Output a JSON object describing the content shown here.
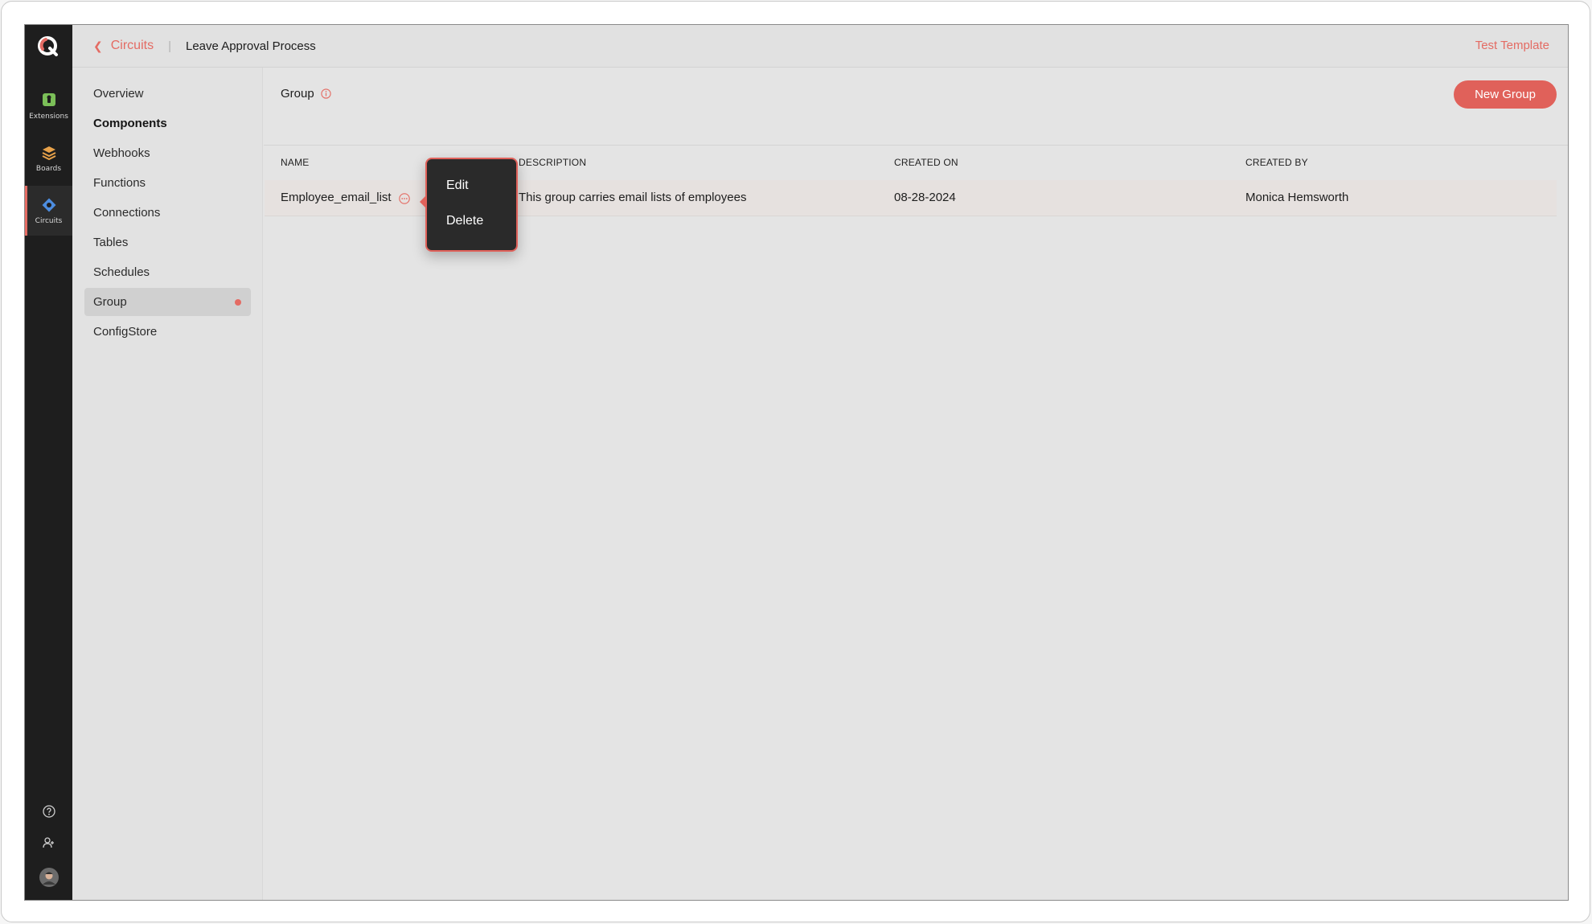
{
  "rail": {
    "items": [
      {
        "label": "Extensions",
        "icon": "extensions-icon",
        "color": "#7bbf58"
      },
      {
        "label": "Boards",
        "icon": "boards-icon",
        "color": "#e8a24a"
      },
      {
        "label": "Circuits",
        "icon": "circuits-icon",
        "color": "#4d8de0"
      }
    ],
    "active": "Circuits"
  },
  "breadcrumb": {
    "back_label": "Circuits",
    "separator": "|",
    "current": "Leave Approval Process"
  },
  "header": {
    "test_template_label": "Test Template"
  },
  "subnav": {
    "items": [
      {
        "label": "Overview"
      },
      {
        "label": "Components",
        "header": true
      },
      {
        "label": "Webhooks"
      },
      {
        "label": "Functions"
      },
      {
        "label": "Connections"
      },
      {
        "label": "Tables"
      },
      {
        "label": "Schedules"
      },
      {
        "label": "Group",
        "selected": true
      },
      {
        "label": "ConfigStore"
      }
    ]
  },
  "main": {
    "title": "Group",
    "new_group_label": "New Group",
    "columns": [
      "NAME",
      "DESCRIPTION",
      "CREATED ON",
      "CREATED BY"
    ],
    "rows": [
      {
        "name": "Employee_email_list",
        "description": "This group carries email lists of employees",
        "created_on": "08-28-2024",
        "created_by": "Monica Hemsworth"
      }
    ]
  },
  "context_menu": {
    "items": [
      "Edit",
      "Delete"
    ]
  },
  "colors": {
    "accent": "#e0615a",
    "rail_bg": "#1e1e1e",
    "menu_bg": "#2a2a2a"
  }
}
